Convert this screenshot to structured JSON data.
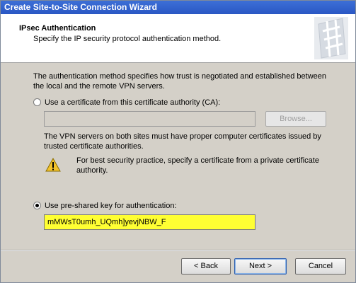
{
  "window": {
    "title": "Create Site-to-Site Connection Wizard"
  },
  "header": {
    "title": "IPsec Authentication",
    "subtitle": "Specify the IP security protocol authentication method."
  },
  "content": {
    "intro": "The authentication method specifies how trust is negotiated and established between the local and the remote VPN servers.",
    "option_certificate": "Use a certificate from this certificate authority (CA):",
    "browse_label": "Browse...",
    "cert_note": "The VPN servers on both sites must have proper computer certificates issued by trusted certificate authorities.",
    "warning_text": "For best security practice, specify a certificate from a private certificate authority.",
    "option_psk": "Use pre-shared key for authentication:",
    "psk_value": "mMWsT0umh_UQmh]yevjNBW_F",
    "selected_option": "psk"
  },
  "footer": {
    "back_label": "< Back",
    "next_label": "Next >",
    "cancel_label": "Cancel"
  },
  "colors": {
    "title_bar": "#2a57c4",
    "key_field_background": "#ffff33"
  },
  "icons": {
    "warning": "warning-icon",
    "wizard_logo": "wizard-logo"
  }
}
